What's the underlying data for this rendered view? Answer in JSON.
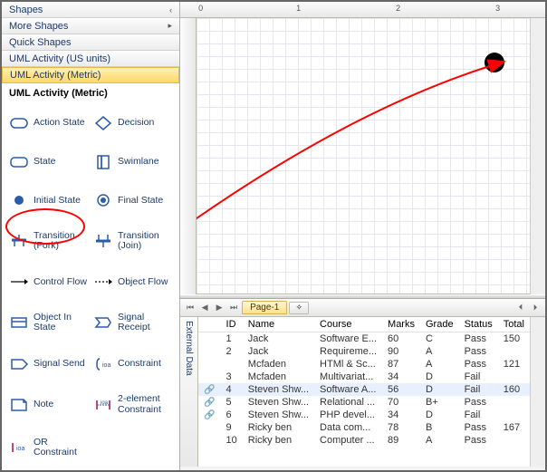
{
  "sidebar": {
    "accordion": [
      {
        "label": "Shapes",
        "chev": "‹"
      },
      {
        "label": "More Shapes",
        "chev": "▸"
      },
      {
        "label": "Quick Shapes",
        "chev": ""
      },
      {
        "label": "UML Activity (US units)",
        "chev": ""
      },
      {
        "label": "UML Activity (Metric)",
        "chev": "",
        "active": true
      }
    ],
    "section_title": "UML Activity (Metric)",
    "shapes": [
      {
        "name": "action-state",
        "label": "Action State"
      },
      {
        "name": "decision",
        "label": "Decision"
      },
      {
        "name": "state",
        "label": "State"
      },
      {
        "name": "swimlane",
        "label": "Swimlane"
      },
      {
        "name": "initial-state",
        "label": "Initial State"
      },
      {
        "name": "final-state",
        "label": "Final State"
      },
      {
        "name": "transition-fork",
        "label": "Transition (Fork)"
      },
      {
        "name": "transition-join",
        "label": "Transition (Join)"
      },
      {
        "name": "control-flow",
        "label": "Control Flow"
      },
      {
        "name": "object-flow",
        "label": "Object Flow"
      },
      {
        "name": "object-in-state",
        "label": "Object In State"
      },
      {
        "name": "signal-receipt",
        "label": "Signal Receipt"
      },
      {
        "name": "signal-send",
        "label": "Signal Send"
      },
      {
        "name": "constraint",
        "label": "Constraint"
      },
      {
        "name": "note",
        "label": "Note"
      },
      {
        "name": "two-element-constraint",
        "label": "2-element Constraint"
      },
      {
        "name": "or-constraint",
        "label": "OR Constraint"
      }
    ]
  },
  "ruler": {
    "marks": [
      "0",
      "1",
      "2",
      "3"
    ]
  },
  "page_tab": "Page-1",
  "external_tab": "External Data",
  "table": {
    "headers": [
      "ID",
      "Name",
      "Course",
      "Marks",
      "Grade",
      "Status",
      "Total"
    ],
    "rows": [
      {
        "link": false,
        "id": "1",
        "name": "Jack",
        "course": "Software E...",
        "marks": "60",
        "grade": "C",
        "status": "Pass",
        "total": "150"
      },
      {
        "link": false,
        "id": "2",
        "name": "Jack",
        "course": "Requireme...",
        "marks": "90",
        "grade": "A",
        "status": "Pass",
        "total": ""
      },
      {
        "link": false,
        "id": "",
        "name": "Mcfaden",
        "course": "HTMl & Sc...",
        "marks": "87",
        "grade": "A",
        "status": "Pass",
        "total": "121"
      },
      {
        "link": false,
        "id": "3",
        "name": "Mcfaden",
        "course": "Multivariat...",
        "marks": "34",
        "grade": "D",
        "status": "Fail",
        "total": ""
      },
      {
        "link": true,
        "sel": true,
        "id": "4",
        "name": "Steven Shw...",
        "course": "Software A...",
        "marks": "56",
        "grade": "D",
        "status": "Fail",
        "total": "160"
      },
      {
        "link": true,
        "id": "5",
        "name": "Steven Shw...",
        "course": "Relational ...",
        "marks": "70",
        "grade": "B+",
        "status": "Pass",
        "total": ""
      },
      {
        "link": true,
        "id": "6",
        "name": "Steven Shw...",
        "course": "PHP devel...",
        "marks": "34",
        "grade": "D",
        "status": "Fail",
        "total": ""
      },
      {
        "link": false,
        "id": "9",
        "name": "Ricky ben",
        "course": "Data com...",
        "marks": "78",
        "grade": "B",
        "status": "Pass",
        "total": "167"
      },
      {
        "link": false,
        "id": "10",
        "name": "Ricky ben",
        "course": "Computer ...",
        "marks": "89",
        "grade": "A",
        "status": "Pass",
        "total": ""
      }
    ]
  }
}
